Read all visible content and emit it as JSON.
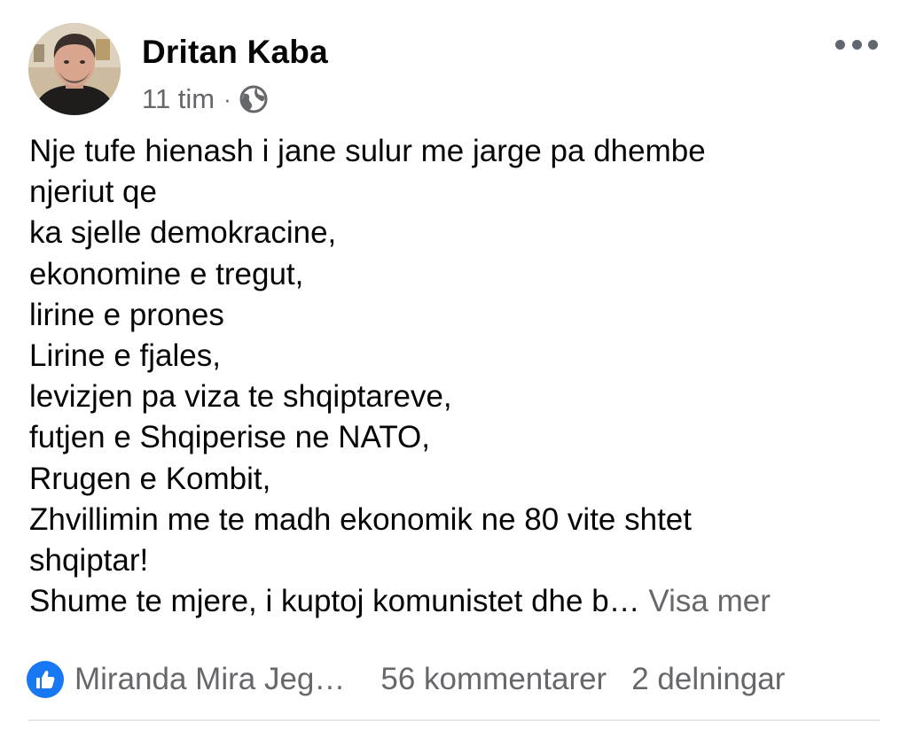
{
  "post": {
    "author": "Dritan Kaba",
    "time": "11 tim",
    "separator": "·",
    "privacy_icon": "globe-icon",
    "body_lines": [
      "Nje tufe hienash i jane sulur me jarge pa dhembe",
      "njeriut qe",
      "ka sjelle demokracine,",
      "ekonomine e tregut,",
      "lirine e prones",
      "Lirine e fjales,",
      "levizjen pa viza te shqiptareve,",
      "futjen e Shqiperise ne NATO,",
      "Rrugen e Kombit,",
      "Zhvillimin me te madh ekonomik ne 80 vite shtet",
      "shqiptar!"
    ],
    "truncated_line": "Shume te mjere, i kuptoj komunistet dhe b…",
    "see_more": "Visa mer"
  },
  "footer": {
    "reaction_icon": "like-icon",
    "reactors": "Miranda Mira Jeg…",
    "comments": "56 kommentarer",
    "shares": "2 delningar"
  },
  "colors": {
    "text": "#050505",
    "secondary": "#65676b",
    "like_blue": "#1877f2",
    "divider": "#e4e6eb"
  }
}
